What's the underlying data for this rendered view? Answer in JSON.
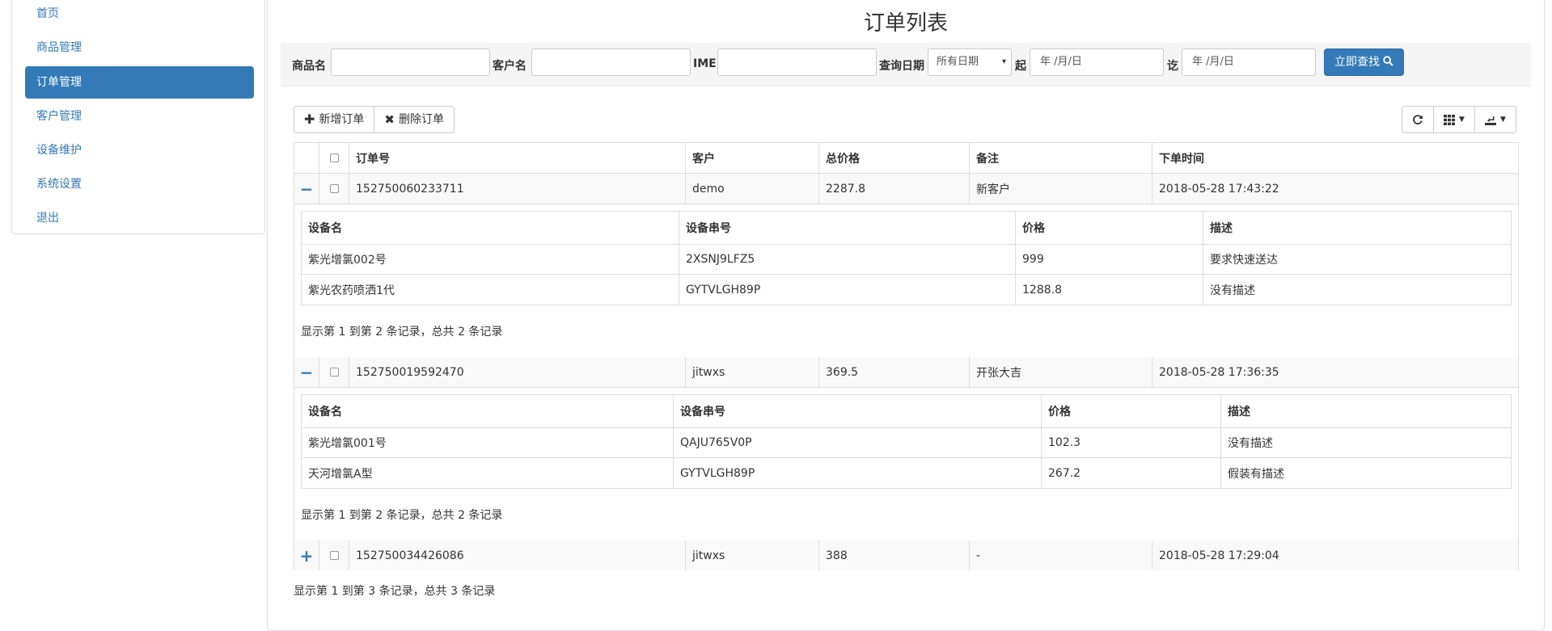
{
  "sidebar": {
    "items": [
      {
        "label": "首页",
        "active": false
      },
      {
        "label": "商品管理",
        "active": false
      },
      {
        "label": "订单管理",
        "active": true
      },
      {
        "label": "客户管理",
        "active": false
      },
      {
        "label": "设备维护",
        "active": false
      },
      {
        "label": "系统设置",
        "active": false
      },
      {
        "label": "退出",
        "active": false
      }
    ]
  },
  "page_title": "订单列表",
  "search": {
    "product_label": "商品名",
    "customer_label": "客户名",
    "imei_label": "IMEI",
    "date_label": "查询日期",
    "date_select": "所有日期",
    "from_label": "起",
    "from_placeholder": "年 /月/日",
    "to_label": "讫",
    "to_placeholder": "年 /月/日",
    "search_button": "立即查找"
  },
  "toolbar": {
    "add_button": "新增订单",
    "delete_button": "删除订单",
    "refresh_icon": "refresh-icon",
    "columns_icon": "columns-icon",
    "export_icon": "export-icon"
  },
  "table": {
    "columns": [
      "订单号",
      "客户",
      "总价格",
      "备注",
      "下单时间"
    ],
    "orders": [
      {
        "expanded": true,
        "toggle": "−",
        "order_no": "152750060233711",
        "customer": "demo",
        "total": "2287.8",
        "note": "新客户",
        "time": "2018-05-28 17:43:22",
        "detail_columns": [
          "设备名",
          "设备串号",
          "价格",
          "描述"
        ],
        "details": [
          {
            "name": "紫光增氯002号",
            "serial": "2XSNJ9LFZ5",
            "price": "999",
            "desc": "要求快速送达"
          },
          {
            "name": "紫光农药喷洒1代",
            "serial": "GYTVLGH89P",
            "price": "1288.8",
            "desc": "没有描述"
          }
        ],
        "detail_footer": "显示第 1 到第 2 条记录，总共 2 条记录"
      },
      {
        "expanded": true,
        "toggle": "−",
        "order_no": "152750019592470",
        "customer": "jitwxs",
        "total": "369.5",
        "note": "开张大吉",
        "time": "2018-05-28 17:36:35",
        "detail_columns": [
          "设备名",
          "设备串号",
          "价格",
          "描述"
        ],
        "details": [
          {
            "name": "紫光增氯001号",
            "serial": "QAJU765V0P",
            "price": "102.3",
            "desc": "没有描述"
          },
          {
            "name": "天河增氯A型",
            "serial": "GYTVLGH89P",
            "price": "267.2",
            "desc": "假装有描述"
          }
        ],
        "detail_footer": "显示第 1 到第 2 条记录，总共 2 条记录"
      },
      {
        "expanded": false,
        "toggle": "+",
        "order_no": "152750034426086",
        "customer": "jitwxs",
        "total": "388",
        "note": "-",
        "time": "2018-05-28 17:29:04"
      }
    ]
  },
  "footer": "显示第 1 到第 3 条记录，总共 3 条记录",
  "colors": {
    "primary": "#337ab7",
    "border": "#dddddd",
    "shaded": "#f9f9f9"
  }
}
